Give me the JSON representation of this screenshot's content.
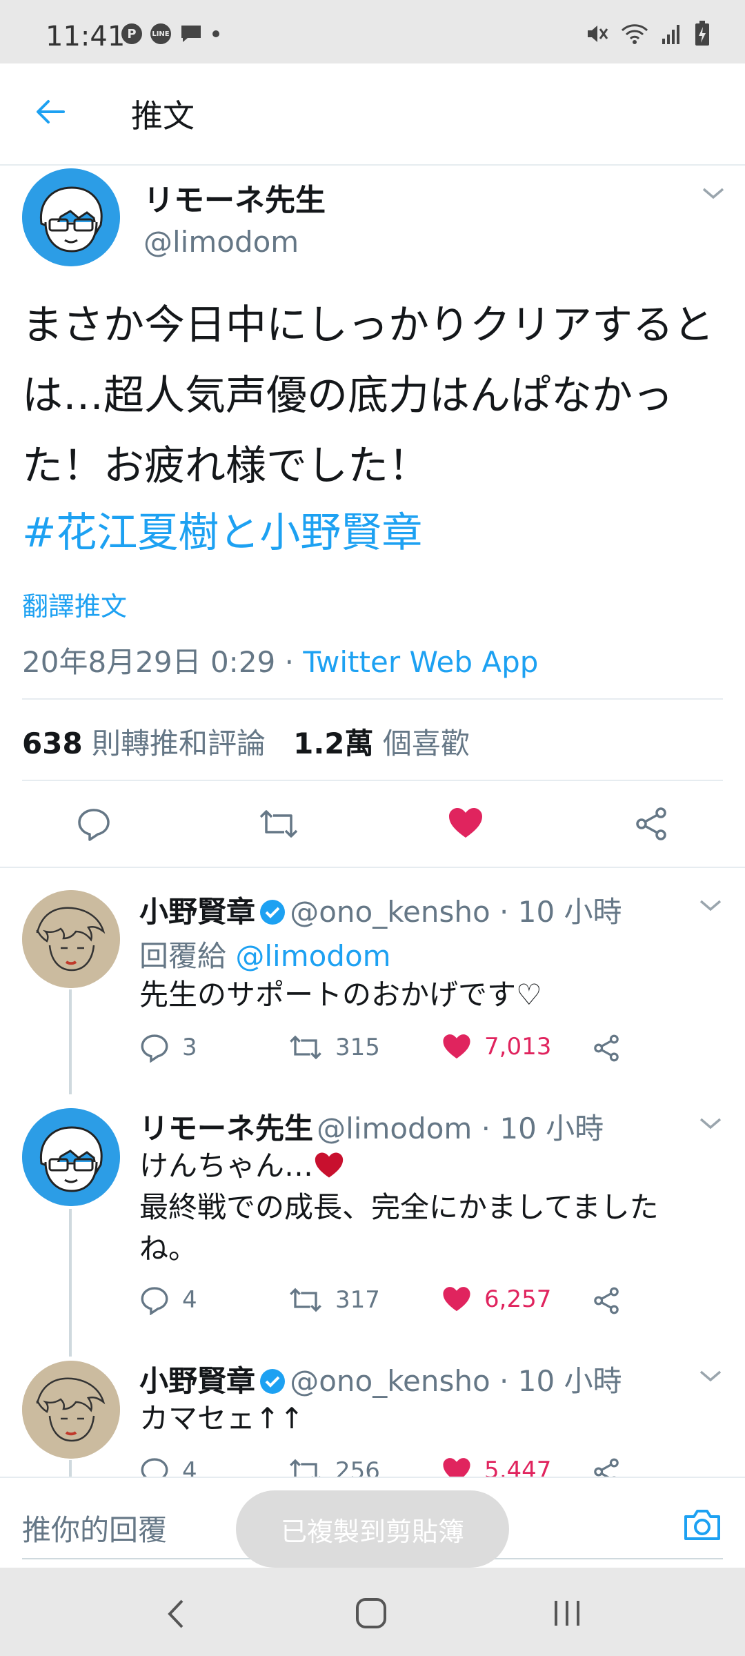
{
  "status_bar": {
    "time": "11:41"
  },
  "header": {
    "title": "推文"
  },
  "main_tweet": {
    "name": "リモーネ先生",
    "handle": "@limodom",
    "text": "まさか今日中にしっかりクリアするとは…超人気声優の底力はんぱなかった！お疲れ様でした！",
    "hashtag": "#花江夏樹と小野賢章",
    "translate": "翻譯推文",
    "date": "20年8月29日 0:29 · ",
    "source": "Twitter Web App",
    "retweets_count": "638",
    "retweets_label": " 則轉推和評論",
    "likes_count": "1.2萬",
    "likes_label": " 個喜歡"
  },
  "replies": [
    {
      "name": "小野賢章",
      "handle_time": "@ono_kensho · 10 小時",
      "reply_to_label": "回覆給 ",
      "reply_to": "@limodom",
      "text": "先生のサポートのおかげです♡",
      "reply_count": "3",
      "retweet_count": "315",
      "like_count": "7,013"
    },
    {
      "name": "リモーネ先生",
      "handle_time": "@limodom · 10 小時",
      "text1": "けんちゃん…",
      "text2": "最終戦での成長、完全にかましてました",
      "text3": "ね。",
      "reply_count": "4",
      "retweet_count": "317",
      "like_count": "6,257"
    },
    {
      "name": "小野賢章",
      "handle_time": "@ono_kensho · 10 小時",
      "text": "カマセェ↑↑",
      "reply_count": "4",
      "retweet_count": "256",
      "like_count": "5,447"
    }
  ],
  "composer": {
    "placeholder": "推你的回覆"
  },
  "toast": "已複製到剪貼簿",
  "colors": {
    "accent": "#1da1f2",
    "like": "#e0245e",
    "text": "#14171a",
    "muted": "#657786"
  }
}
